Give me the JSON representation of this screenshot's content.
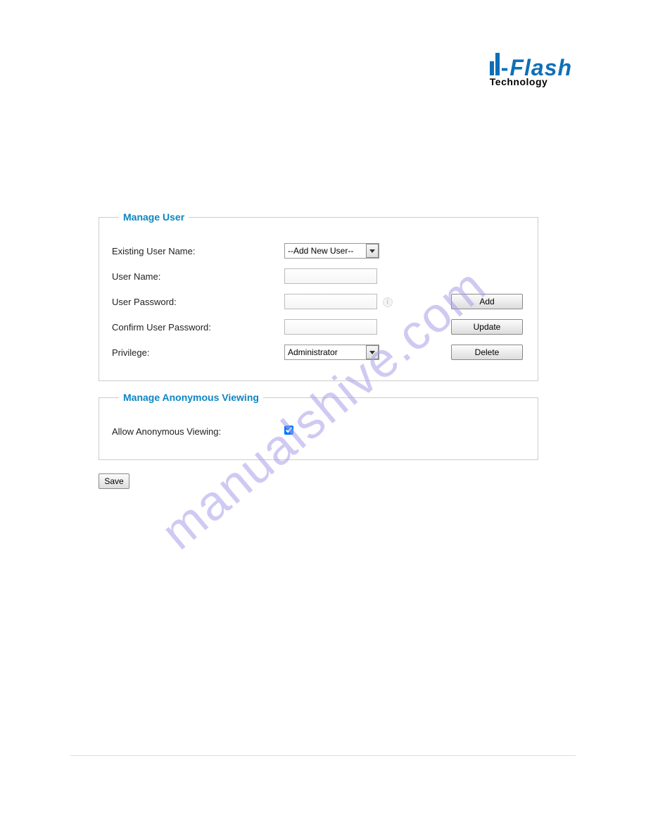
{
  "logo": {
    "brand": "i-Flash",
    "subtitle": "Technology"
  },
  "manage_user": {
    "legend": "Manage User",
    "existing_user_label": "Existing User Name:",
    "existing_user_value": "--Add New User--",
    "user_name_label": "User Name:",
    "user_name_value": "",
    "user_password_label": "User Password:",
    "user_password_value": "",
    "confirm_password_label": "Confirm User Password:",
    "confirm_password_value": "",
    "privilege_label": "Privilege:",
    "privilege_value": "Administrator",
    "add_button": "Add",
    "update_button": "Update",
    "delete_button": "Delete"
  },
  "anonymous": {
    "legend": "Manage Anonymous Viewing",
    "allow_label": "Allow Anonymous Viewing:",
    "allow_checked": true
  },
  "save_button": "Save",
  "watermark": "manualshive.com"
}
